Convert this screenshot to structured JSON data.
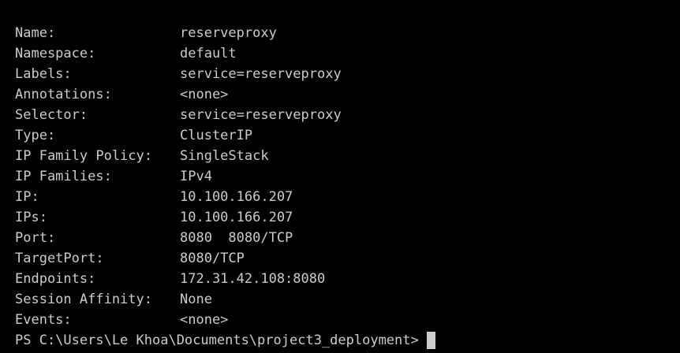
{
  "theme": {
    "background": "#000000",
    "foreground": "#cccccc"
  },
  "service": [
    {
      "key": "Name:",
      "value": "reserveproxy"
    },
    {
      "key": "Namespace:",
      "value": "default"
    },
    {
      "key": "Labels:",
      "value": "service=reserveproxy"
    },
    {
      "key": "Annotations:",
      "value": "<none>"
    },
    {
      "key": "Selector:",
      "value": "service=reserveproxy"
    },
    {
      "key": "Type:",
      "value": "ClusterIP"
    },
    {
      "key": "IP Family Policy:",
      "value": "SingleStack"
    },
    {
      "key": "IP Families:",
      "value": "IPv4"
    },
    {
      "key": "IP:",
      "value": "10.100.166.207"
    },
    {
      "key": "IPs:",
      "value": "10.100.166.207"
    },
    {
      "key": "Port:",
      "value": "8080  8080/TCP"
    },
    {
      "key": "TargetPort:",
      "value": "8080/TCP"
    },
    {
      "key": "Endpoints:",
      "value": "172.31.42.108:8080"
    },
    {
      "key": "Session Affinity:",
      "value": "None"
    },
    {
      "key": "Events:",
      "value": "<none>"
    }
  ],
  "prompt": {
    "text": "PS C:\\Users\\Le Khoa\\Documents\\project3_deployment>"
  }
}
